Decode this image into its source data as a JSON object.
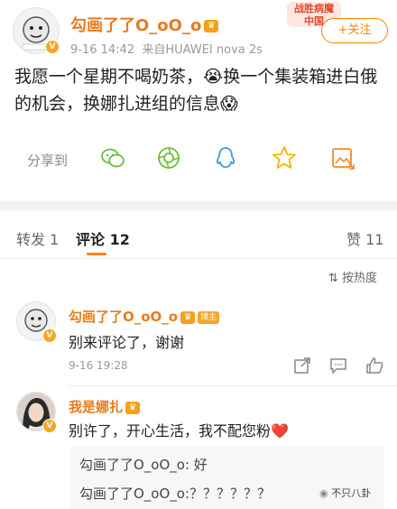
{
  "post": {
    "author": "勾画了了O_oO_o",
    "crown": "♛",
    "time": "9-16 14:42",
    "source": "来自HUAWEI nova 2s",
    "promo_line1": "战胜病魔",
    "promo_line2": "中国",
    "follow_label": "+关注",
    "text": "我愿一个星期不喝奶茶，😭换一个集装箱进白俄的机会，换娜扎进组的信息😱"
  },
  "share": {
    "label": "分享到",
    "icons": [
      "wechat-icon",
      "moments-icon",
      "qq-icon",
      "favorite-star-icon",
      "save-image-icon"
    ]
  },
  "tabs": {
    "repost": "转发 1",
    "comments": "评论 12",
    "likes": "赞 11"
  },
  "sort_label": "按热度",
  "comments": [
    {
      "name": "勾画了了O_oO_o",
      "owner_tag": "博主",
      "text": "别来评论了，谢谢",
      "time": "9-16 19:28"
    },
    {
      "name": "我是娜扎",
      "text": "别许了，开心生活，我不配您粉❤️",
      "replies": [
        "勾画了了O_oO_o: 好",
        "勾画了了O_oO_o:？？？？？？"
      ]
    }
  ],
  "watermark": "不只八卦",
  "colors": {
    "accent": "#ff8200",
    "username": "#e87b1e"
  }
}
